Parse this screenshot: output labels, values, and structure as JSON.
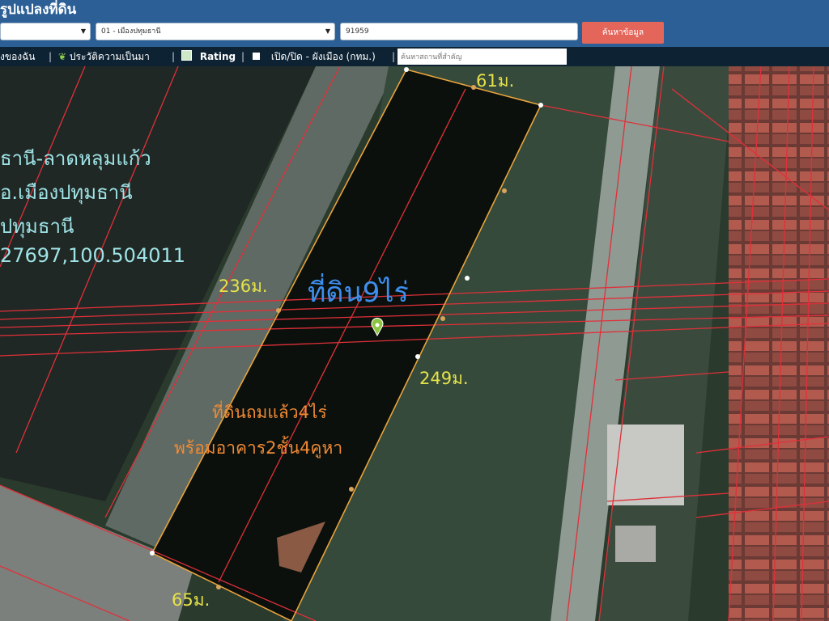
{
  "header": {
    "title": "รูปแปลงที่ดิน",
    "province_select": {
      "value": ""
    },
    "district_select": {
      "value": "01 - เมืองปทุมธานี"
    },
    "parcel_input": {
      "value": "91959"
    },
    "search_button": "ค้นหาข้อมูล"
  },
  "toolbar": {
    "my_data": "งของฉัน",
    "history": "ประวัติความเป็นมา",
    "rating": "Rating",
    "city_plan": "เปิด/ปิด - ผังเมือง (กทม.)",
    "place_search_placeholder": "ค้นหาสถานที่สำคัญ",
    "sep": "|"
  },
  "map_labels": {
    "info_line1": "ธานี-ลาดหลุมแก้ว",
    "info_line2": "อ.เมืองปทุมธานี",
    "info_line3": "ปทุมธานี",
    "info_line4": "27697,100.504011",
    "land_size": "ที่ดิน9ไร่",
    "filled_land": "ที่ดินถมแล้ว4ไร่",
    "building": "พร้อมอาคาร2ชั้น4คูหา",
    "dim_top": "61ม.",
    "dim_left": "236ม.",
    "dim_right": "249ม.",
    "dim_bottom": "65ม."
  },
  "colors": {
    "header_bg": "#2c5f95",
    "toolbar_bg": "#0d2233",
    "search_button": "#e4665b",
    "parcel_outline": "#e8a33c",
    "cadastral_lines": "#e0303a",
    "info_text": "#9fe3e6",
    "dimension_text": "#e6e24a",
    "land_size_text": "#3d8ff0",
    "note_text": "#ef8a35"
  }
}
